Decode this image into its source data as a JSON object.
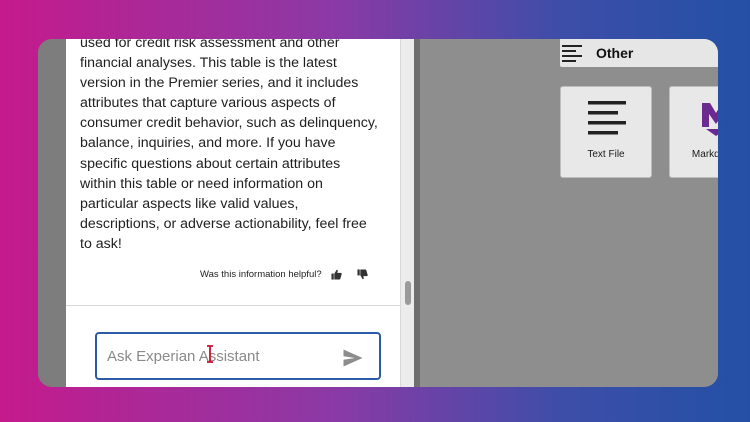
{
  "chat": {
    "message_lines": [
      "used for credit risk assessment and other",
      "financial analyses. This table is the latest",
      "version in the Premier series, and it includes",
      "attributes that capture various aspects of",
      "consumer credit behavior, such as delinquency,",
      "balance, inquiries, and more. If you have",
      "specific questions about certain attributes",
      "within this table or need information on",
      "particular aspects like valid values,",
      "descriptions, or adverse actionability, feel free",
      "to ask!"
    ],
    "feedback_prompt": "Was this information helpful?",
    "input_placeholder": "Ask Experian Assistant",
    "icons": {
      "thumbs_up": "thumbs-up-icon",
      "thumbs_down": "thumbs-down-icon",
      "send": "send-icon"
    }
  },
  "side": {
    "section_label": "Other",
    "cards": [
      {
        "label": "Text File",
        "icon": "text-file-icon"
      },
      {
        "label": "Markdown",
        "icon": "markdown-icon"
      }
    ]
  },
  "colors": {
    "input_border": "#2c5aa6",
    "markdown_icon": "#6b2a8f",
    "background_left": "#c51a8c",
    "background_right": "#2350a5"
  }
}
